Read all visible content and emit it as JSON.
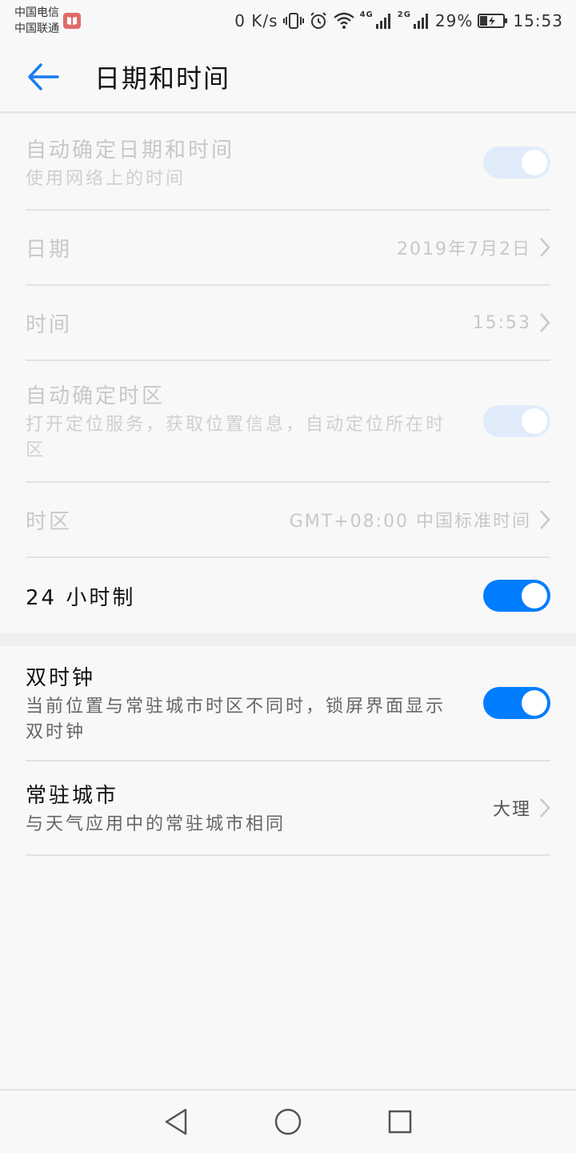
{
  "status_bar": {
    "carrier1": "中国电信",
    "carrier2": "中国联通",
    "net_speed": "0 K/s",
    "net_4g": "4G",
    "net_2g": "2G",
    "battery": "29%",
    "time": "15:53"
  },
  "header": {
    "title": "日期和时间",
    "back_icon": "back-arrow-icon"
  },
  "settings": {
    "auto_datetime": {
      "title": "自动确定日期和时间",
      "subtitle": "使用网络上的时间",
      "state": "on-disabled"
    },
    "date": {
      "title": "日期",
      "value": "2019年7月2日"
    },
    "time": {
      "title": "时间",
      "value": "15:53"
    },
    "auto_timezone": {
      "title": "自动确定时区",
      "subtitle": "打开定位服务，获取位置信息，自动定位所在时区",
      "state": "on-disabled"
    },
    "timezone": {
      "title": "时区",
      "value": "GMT+08:00 中国标准时间"
    },
    "hour24": {
      "title": "24 小时制",
      "state": "on"
    },
    "dual_clock": {
      "title": "双时钟",
      "subtitle": "当前位置与常驻城市时区不同时，锁屏界面显示双时钟",
      "state": "on"
    },
    "home_city": {
      "title": "常驻城市",
      "subtitle": "与天气应用中的常驻城市相同",
      "value": "大理"
    }
  },
  "colors": {
    "accent": "#007dff",
    "toggle_disabled": "#e1ecfb"
  },
  "nav": {
    "back": "triangle-back-icon",
    "home": "circle-home-icon",
    "recents": "square-recents-icon"
  }
}
